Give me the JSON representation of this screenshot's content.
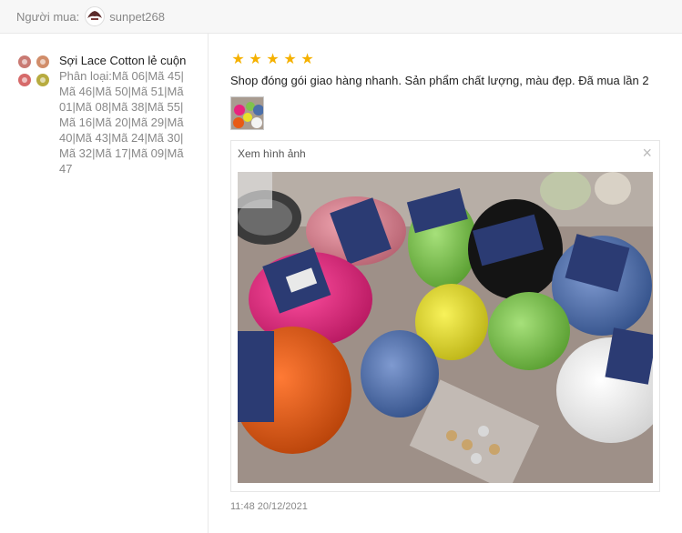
{
  "buyer": {
    "label": "Người mua:",
    "username": "sunpet268"
  },
  "product": {
    "name": "Sợi Lace Cotton lẻ cuộn",
    "variation": "Phân loại:Mã 06|Mã 45|Mã 46|Mã 50|Mã 51|Mã 01|Mã 08|Mã 38|Mã 55|Mã 16|Mã 20|Mã 29|Mã 40|Mã 43|Mã 24|Mã 30|Mã 32|Mã 17|Mã 09|Mã 47"
  },
  "review": {
    "rating": 5,
    "rating_stars": [
      "★",
      "★",
      "★",
      "★",
      "★"
    ],
    "text": "Shop đóng gói giao hàng nhanh. Sản phẩm chất lượng, màu đẹp. Đã mua lần 2",
    "image_panel_title": "Xem hình ảnh",
    "close_symbol": "×",
    "timestamp": "11:48 20/12/2021"
  },
  "colors": {
    "star": "#f5b100",
    "pink": "#d9818f",
    "magenta": "#e8237f",
    "green": "#7fc24c",
    "yellow": "#e9e12a",
    "blue": "#4c6fa9",
    "orange": "#e85a14",
    "black": "#181818",
    "white": "#f4f4f4"
  },
  "icons": {
    "avatar": "buyer-avatar-icon",
    "close": "close-icon",
    "star": "star-icon"
  }
}
